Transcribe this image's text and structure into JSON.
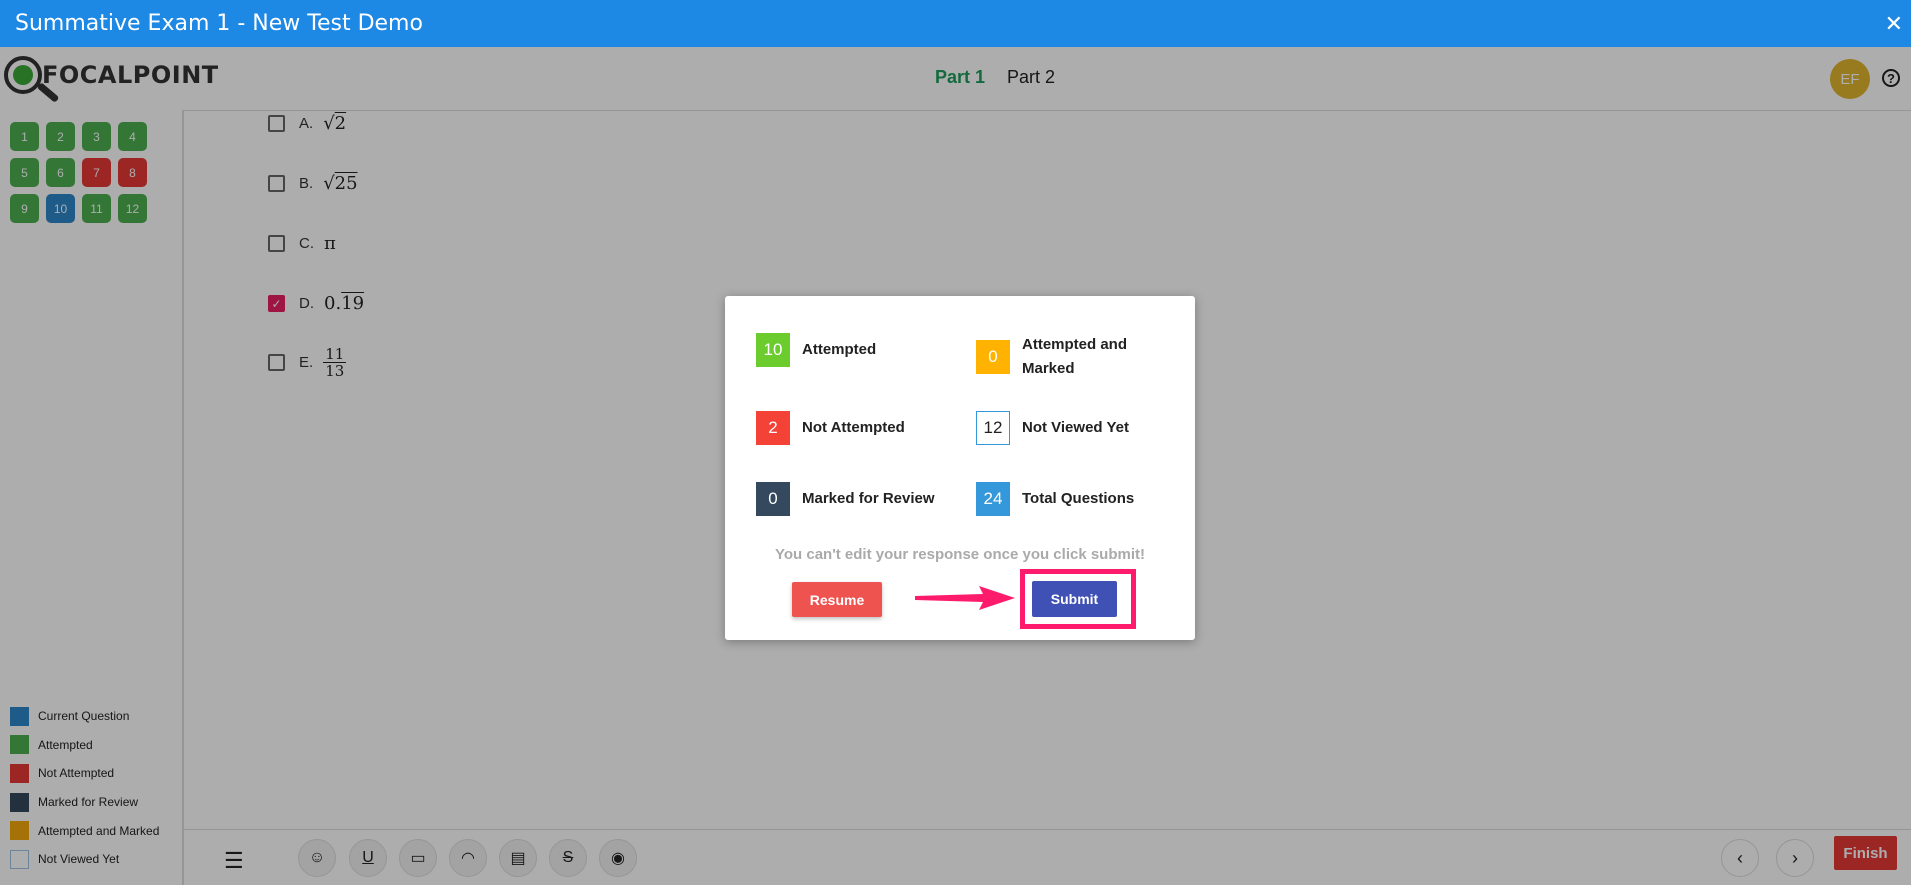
{
  "window": {
    "title": "Summative Exam 1 - New Test Demo",
    "close": "✕"
  },
  "header": {
    "logo_text": "FOCALPOINT",
    "parts": [
      {
        "label": "Part 1",
        "active": true
      },
      {
        "label": "Part 2",
        "active": false
      }
    ],
    "avatar": "EF",
    "help": "?"
  },
  "questions": [
    {
      "num": "1",
      "status": "attempted"
    },
    {
      "num": "2",
      "status": "attempted"
    },
    {
      "num": "3",
      "status": "attempted"
    },
    {
      "num": "4",
      "status": "attempted"
    },
    {
      "num": "5",
      "status": "attempted"
    },
    {
      "num": "6",
      "status": "attempted"
    },
    {
      "num": "7",
      "status": "not-attempted"
    },
    {
      "num": "8",
      "status": "not-attempted"
    },
    {
      "num": "9",
      "status": "attempted"
    },
    {
      "num": "10",
      "status": "current"
    },
    {
      "num": "11",
      "status": "attempted"
    },
    {
      "num": "12",
      "status": "attempted"
    }
  ],
  "legend": [
    {
      "label": "Current Question",
      "color": "#2f86c9"
    },
    {
      "label": "Attempted",
      "color": "#4caf50"
    },
    {
      "label": "Not Attempted",
      "color": "#e53935"
    },
    {
      "label": "Marked for Review",
      "color": "#34495e"
    },
    {
      "label": "Attempted and Marked",
      "color": "#f4a80b"
    },
    {
      "label": "Not Viewed Yet",
      "color": "#ffffff"
    }
  ],
  "options": [
    {
      "label": "A.",
      "checked": false
    },
    {
      "label": "B.",
      "checked": false
    },
    {
      "label": "C.",
      "checked": false,
      "value": "π"
    },
    {
      "label": "D.",
      "checked": true
    },
    {
      "label": "E.",
      "checked": false
    }
  ],
  "math": {
    "a_radicand": "2",
    "b_radicand": "25",
    "d_prefix": "0.",
    "d_repeat": "19",
    "e_num": "11",
    "e_den": "13"
  },
  "toolbar": {
    "finish": "Finish",
    "prev": "‹",
    "next": "›"
  },
  "summary": {
    "attempted": {
      "count": "10",
      "label": "Attempted",
      "color": "#6ccc2e"
    },
    "attempted_marked": {
      "count": "0",
      "label": "Attempted and Marked",
      "color": "#ffb300"
    },
    "not_attempted": {
      "count": "2",
      "label": "Not Attempted",
      "color": "#f44336"
    },
    "not_viewed": {
      "count": "12",
      "label": "Not Viewed Yet",
      "color": "#ffffff"
    },
    "marked_review": {
      "count": "0",
      "label": "Marked for Review",
      "color": "#34495e"
    },
    "total": {
      "count": "24",
      "label": "Total Questions",
      "color": "#3498db"
    },
    "warning": "You can't edit your response once you click submit!",
    "resume": "Resume",
    "submit": "Submit"
  }
}
